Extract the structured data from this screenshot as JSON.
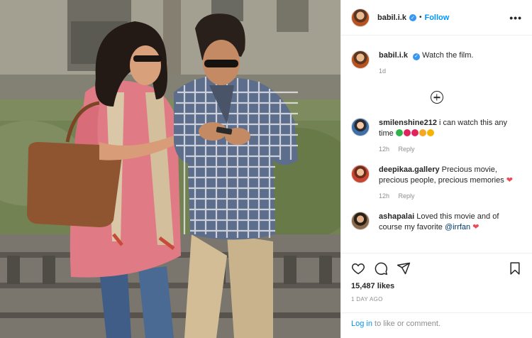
{
  "post": {
    "username": "babil.i.k",
    "follow_label": "Follow",
    "more_label": "•••",
    "caption": {
      "username": "babil.i.k",
      "text": "Watch the film.",
      "time": "1d"
    }
  },
  "comments": [
    {
      "username": "smilenshine212",
      "text": "i can watch this any time",
      "emojis": [
        "#2fb34a",
        "#e0245e",
        "#e0245e",
        "#f5a623",
        "#f5b400"
      ],
      "time": "12h",
      "reply": "Reply"
    },
    {
      "username": "deepikaa.gallery",
      "text": "Precious movie, precious people, precious memories",
      "heart": "❤",
      "time": "12h",
      "reply": "Reply"
    },
    {
      "username": "ashapalai",
      "text": "Loved this movie and of course my favorite",
      "mention": "@irrfan",
      "heart": "❤"
    }
  ],
  "likes": "15,487 likes",
  "posted_ago": "1 DAY AGO",
  "login_bar": {
    "link": "Log in",
    "rest": " to like or comment."
  },
  "colors": {
    "accent": "#0095f6",
    "verified": "#3897f0",
    "heart": "#ed4956"
  }
}
